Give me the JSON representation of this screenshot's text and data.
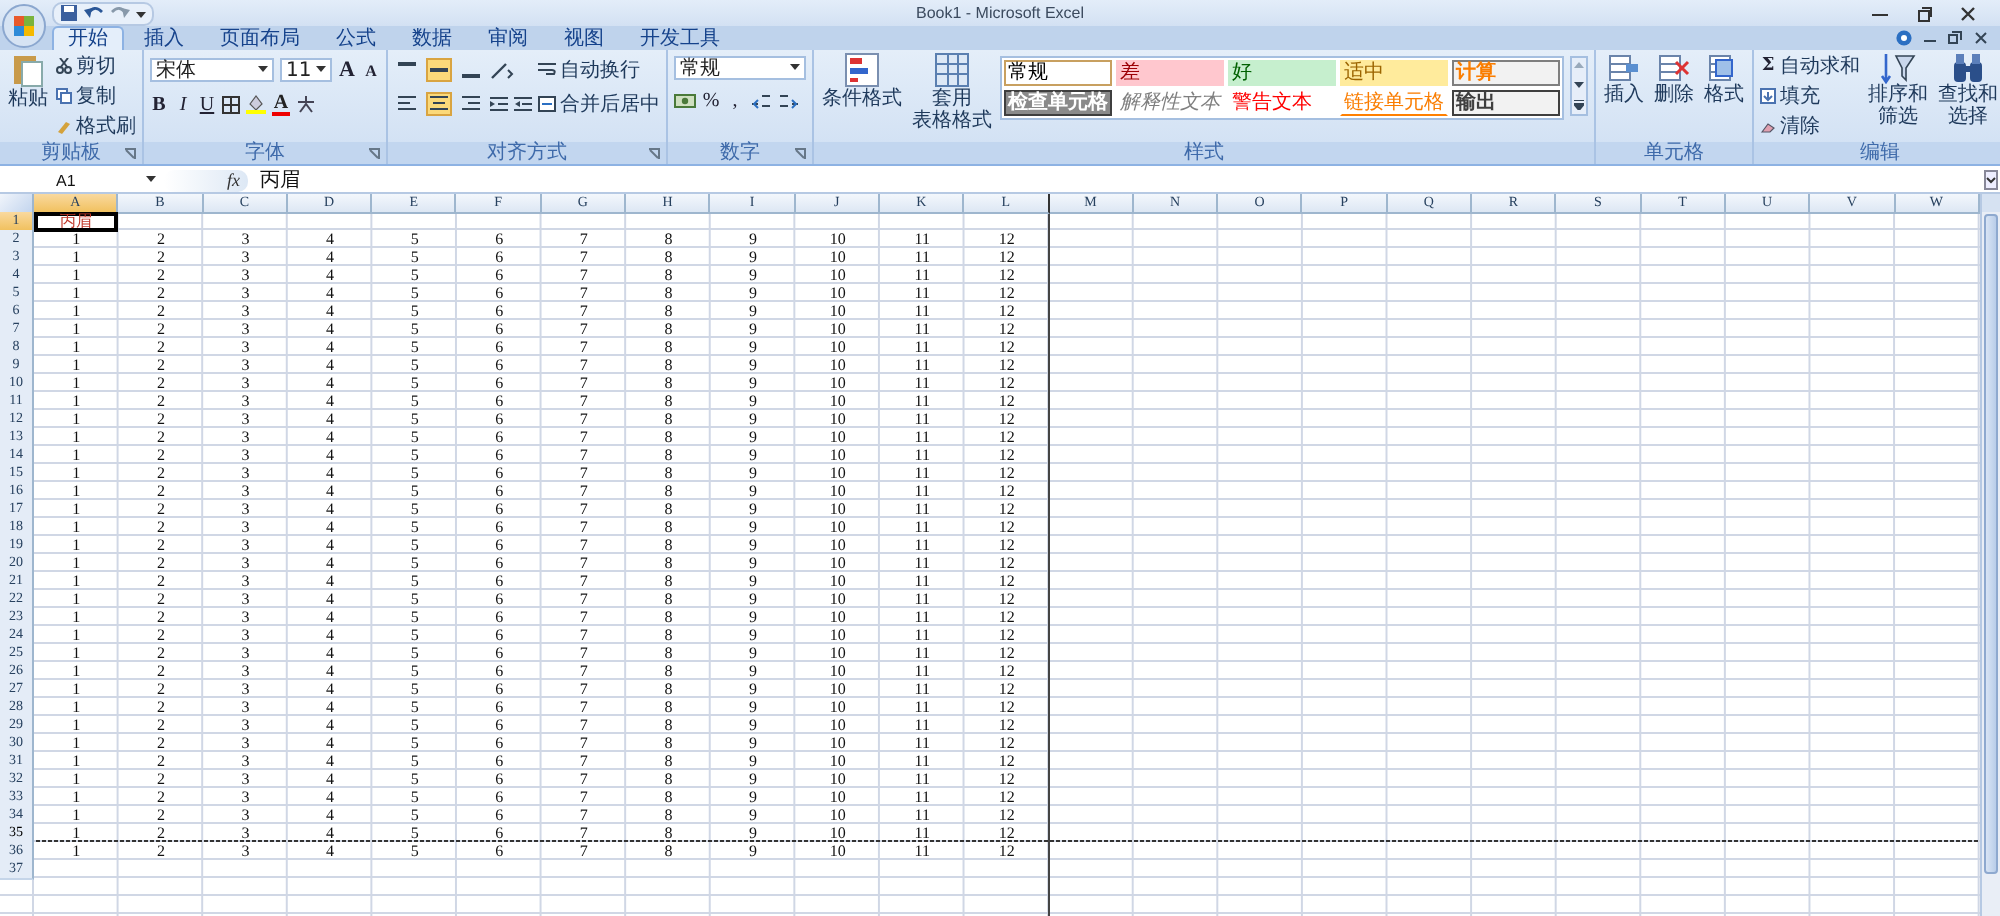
{
  "window": {
    "title": "Book1 - Microsoft Excel"
  },
  "tabs": [
    {
      "label": "开始",
      "selected": true
    },
    {
      "label": "插入",
      "selected": false
    },
    {
      "label": "页面布局",
      "selected": false
    },
    {
      "label": "公式",
      "selected": false
    },
    {
      "label": "数据",
      "selected": false
    },
    {
      "label": "审阅",
      "selected": false
    },
    {
      "label": "视图",
      "selected": false
    },
    {
      "label": "开发工具",
      "selected": false
    }
  ],
  "clipboard": {
    "label": "剪贴板",
    "paste": "粘贴",
    "items": [
      "剪切",
      "复制",
      "格式刷"
    ]
  },
  "font": {
    "label": "字体",
    "font_name": "宋体",
    "font_size": "11",
    "grow": "A",
    "shrink": "A",
    "bold": "B",
    "italic": "I",
    "underline": "U",
    "color_letter": "A"
  },
  "alignment": {
    "label": "对齐方式",
    "vertical": [
      {
        "selected": false
      },
      {
        "selected": true
      },
      {
        "selected": false
      }
    ],
    "horizontal": [
      {
        "selected": false
      },
      {
        "selected": true
      },
      {
        "selected": false
      }
    ],
    "wrap": "自动换行",
    "merge": "合并后居中"
  },
  "number": {
    "label": "数字",
    "format": "常规",
    "percent": "%",
    "comma": ","
  },
  "styles": {
    "label": "样式",
    "conditional": "条件格式",
    "table_format": [
      "套用",
      "表格格式"
    ],
    "cell_styles": [
      {
        "label": "常规",
        "kind": "normal"
      },
      {
        "label": "差",
        "kind": "bad"
      },
      {
        "label": "好",
        "kind": "good"
      },
      {
        "label": "适中",
        "kind": "neutral"
      },
      {
        "label": "计算",
        "kind": "calculation"
      },
      {
        "label": "检查单元格",
        "kind": "check"
      },
      {
        "label": "解释性文本",
        "kind": "explanatory"
      },
      {
        "label": "警告文本",
        "kind": "warning"
      },
      {
        "label": "链接单元格",
        "kind": "linked"
      },
      {
        "label": "输出",
        "kind": "output"
      }
    ]
  },
  "cells": {
    "label": "单元格",
    "buttons": [
      "插入",
      "删除",
      "格式"
    ]
  },
  "editing": {
    "label": "编辑",
    "sum_symbol": "Σ",
    "items": [
      "自动求和",
      "填充",
      "清除"
    ],
    "sort": [
      "排序和",
      "筛选"
    ],
    "find": [
      "查找和",
      "选择"
    ]
  },
  "formula_bar": {
    "name_box": "A1",
    "function_label": "fx",
    "content": "丙眉"
  },
  "columns": [
    {
      "label": "A",
      "selected": true,
      "page_break": false
    },
    {
      "label": "B",
      "selected": false,
      "page_break": false
    },
    {
      "label": "C",
      "selected": false,
      "page_break": false
    },
    {
      "label": "D",
      "selected": false,
      "page_break": false
    },
    {
      "label": "E",
      "selected": false,
      "page_break": false
    },
    {
      "label": "F",
      "selected": false,
      "page_break": false
    },
    {
      "label": "G",
      "selected": false,
      "page_break": false
    },
    {
      "label": "H",
      "selected": false,
      "page_break": false
    },
    {
      "label": "I",
      "selected": false,
      "page_break": false
    },
    {
      "label": "J",
      "selected": false,
      "page_break": false
    },
    {
      "label": "K",
      "selected": false,
      "page_break": false
    },
    {
      "label": "L",
      "selected": false,
      "page_break": true
    },
    {
      "label": "M",
      "selected": false,
      "page_break": false
    },
    {
      "label": "N",
      "selected": false,
      "page_break": false
    },
    {
      "label": "O",
      "selected": false,
      "page_break": false
    },
    {
      "label": "P",
      "selected": false,
      "page_break": false
    },
    {
      "label": "Q",
      "selected": false,
      "page_break": false
    },
    {
      "label": "R",
      "selected": false,
      "page_break": false
    },
    {
      "label": "S",
      "selected": false,
      "page_break": false
    },
    {
      "label": "T",
      "selected": false,
      "page_break": false
    },
    {
      "label": "U",
      "selected": false,
      "page_break": false
    },
    {
      "label": "V",
      "selected": false,
      "page_break": false
    },
    {
      "label": "W",
      "selected": false,
      "page_break": false
    }
  ],
  "rows": [
    {
      "number": "1",
      "selected": true,
      "page_break": false,
      "cells": [
        "丙眉"
      ]
    },
    {
      "number": "2",
      "selected": false,
      "page_break": false,
      "cells": [
        "1",
        "2",
        "3",
        "4",
        "5",
        "6",
        "7",
        "8",
        "9",
        "10",
        "11",
        "12"
      ]
    },
    {
      "number": "3",
      "selected": false,
      "page_break": false,
      "cells": [
        "1",
        "2",
        "3",
        "4",
        "5",
        "6",
        "7",
        "8",
        "9",
        "10",
        "11",
        "12"
      ]
    },
    {
      "number": "4",
      "selected": false,
      "page_break": false,
      "cells": [
        "1",
        "2",
        "3",
        "4",
        "5",
        "6",
        "7",
        "8",
        "9",
        "10",
        "11",
        "12"
      ]
    },
    {
      "number": "5",
      "selected": false,
      "page_break": false,
      "cells": [
        "1",
        "2",
        "3",
        "4",
        "5",
        "6",
        "7",
        "8",
        "9",
        "10",
        "11",
        "12"
      ]
    },
    {
      "number": "6",
      "selected": false,
      "page_break": false,
      "cells": [
        "1",
        "2",
        "3",
        "4",
        "5",
        "6",
        "7",
        "8",
        "9",
        "10",
        "11",
        "12"
      ]
    },
    {
      "number": "7",
      "selected": false,
      "page_break": false,
      "cells": [
        "1",
        "2",
        "3",
        "4",
        "5",
        "6",
        "7",
        "8",
        "9",
        "10",
        "11",
        "12"
      ]
    },
    {
      "number": "8",
      "selected": false,
      "page_break": false,
      "cells": [
        "1",
        "2",
        "3",
        "4",
        "5",
        "6",
        "7",
        "8",
        "9",
        "10",
        "11",
        "12"
      ]
    },
    {
      "number": "9",
      "selected": false,
      "page_break": false,
      "cells": [
        "1",
        "2",
        "3",
        "4",
        "5",
        "6",
        "7",
        "8",
        "9",
        "10",
        "11",
        "12"
      ]
    },
    {
      "number": "10",
      "selected": false,
      "page_break": false,
      "cells": [
        "1",
        "2",
        "3",
        "4",
        "5",
        "6",
        "7",
        "8",
        "9",
        "10",
        "11",
        "12"
      ]
    },
    {
      "number": "11",
      "selected": false,
      "page_break": false,
      "cells": [
        "1",
        "2",
        "3",
        "4",
        "5",
        "6",
        "7",
        "8",
        "9",
        "10",
        "11",
        "12"
      ]
    },
    {
      "number": "12",
      "selected": false,
      "page_break": false,
      "cells": [
        "1",
        "2",
        "3",
        "4",
        "5",
        "6",
        "7",
        "8",
        "9",
        "10",
        "11",
        "12"
      ]
    },
    {
      "number": "13",
      "selected": false,
      "page_break": false,
      "cells": [
        "1",
        "2",
        "3",
        "4",
        "5",
        "6",
        "7",
        "8",
        "9",
        "10",
        "11",
        "12"
      ]
    },
    {
      "number": "14",
      "selected": false,
      "page_break": false,
      "cells": [
        "1",
        "2",
        "3",
        "4",
        "5",
        "6",
        "7",
        "8",
        "9",
        "10",
        "11",
        "12"
      ]
    },
    {
      "number": "15",
      "selected": false,
      "page_break": false,
      "cells": [
        "1",
        "2",
        "3",
        "4",
        "5",
        "6",
        "7",
        "8",
        "9",
        "10",
        "11",
        "12"
      ]
    },
    {
      "number": "16",
      "selected": false,
      "page_break": false,
      "cells": [
        "1",
        "2",
        "3",
        "4",
        "5",
        "6",
        "7",
        "8",
        "9",
        "10",
        "11",
        "12"
      ]
    },
    {
      "number": "17",
      "selected": false,
      "page_break": false,
      "cells": [
        "1",
        "2",
        "3",
        "4",
        "5",
        "6",
        "7",
        "8",
        "9",
        "10",
        "11",
        "12"
      ]
    },
    {
      "number": "18",
      "selected": false,
      "page_break": false,
      "cells": [
        "1",
        "2",
        "3",
        "4",
        "5",
        "6",
        "7",
        "8",
        "9",
        "10",
        "11",
        "12"
      ]
    },
    {
      "number": "19",
      "selected": false,
      "page_break": false,
      "cells": [
        "1",
        "2",
        "3",
        "4",
        "5",
        "6",
        "7",
        "8",
        "9",
        "10",
        "11",
        "12"
      ]
    },
    {
      "number": "20",
      "selected": false,
      "page_break": false,
      "cells": [
        "1",
        "2",
        "3",
        "4",
        "5",
        "6",
        "7",
        "8",
        "9",
        "10",
        "11",
        "12"
      ]
    },
    {
      "number": "21",
      "selected": false,
      "page_break": false,
      "cells": [
        "1",
        "2",
        "3",
        "4",
        "5",
        "6",
        "7",
        "8",
        "9",
        "10",
        "11",
        "12"
      ]
    },
    {
      "number": "22",
      "selected": false,
      "page_break": false,
      "cells": [
        "1",
        "2",
        "3",
        "4",
        "5",
        "6",
        "7",
        "8",
        "9",
        "10",
        "11",
        "12"
      ]
    },
    {
      "number": "23",
      "selected": false,
      "page_break": false,
      "cells": [
        "1",
        "2",
        "3",
        "4",
        "5",
        "6",
        "7",
        "8",
        "9",
        "10",
        "11",
        "12"
      ]
    },
    {
      "number": "24",
      "selected": false,
      "page_break": false,
      "cells": [
        "1",
        "2",
        "3",
        "4",
        "5",
        "6",
        "7",
        "8",
        "9",
        "10",
        "11",
        "12"
      ]
    },
    {
      "number": "25",
      "selected": false,
      "page_break": false,
      "cells": [
        "1",
        "2",
        "3",
        "4",
        "5",
        "6",
        "7",
        "8",
        "9",
        "10",
        "11",
        "12"
      ]
    },
    {
      "number": "26",
      "selected": false,
      "page_break": false,
      "cells": [
        "1",
        "2",
        "3",
        "4",
        "5",
        "6",
        "7",
        "8",
        "9",
        "10",
        "11",
        "12"
      ]
    },
    {
      "number": "27",
      "selected": false,
      "page_break": false,
      "cells": [
        "1",
        "2",
        "3",
        "4",
        "5",
        "6",
        "7",
        "8",
        "9",
        "10",
        "11",
        "12"
      ]
    },
    {
      "number": "28",
      "selected": false,
      "page_break": false,
      "cells": [
        "1",
        "2",
        "3",
        "4",
        "5",
        "6",
        "7",
        "8",
        "9",
        "10",
        "11",
        "12"
      ]
    },
    {
      "number": "29",
      "selected": false,
      "page_break": false,
      "cells": [
        "1",
        "2",
        "3",
        "4",
        "5",
        "6",
        "7",
        "8",
        "9",
        "10",
        "11",
        "12"
      ]
    },
    {
      "number": "30",
      "selected": false,
      "page_break": false,
      "cells": [
        "1",
        "2",
        "3",
        "4",
        "5",
        "6",
        "7",
        "8",
        "9",
        "10",
        "11",
        "12"
      ]
    },
    {
      "number": "31",
      "selected": false,
      "page_break": false,
      "cells": [
        "1",
        "2",
        "3",
        "4",
        "5",
        "6",
        "7",
        "8",
        "9",
        "10",
        "11",
        "12"
      ]
    },
    {
      "number": "32",
      "selected": false,
      "page_break": false,
      "cells": [
        "1",
        "2",
        "3",
        "4",
        "5",
        "6",
        "7",
        "8",
        "9",
        "10",
        "11",
        "12"
      ]
    },
    {
      "number": "33",
      "selected": false,
      "page_break": false,
      "cells": [
        "1",
        "2",
        "3",
        "4",
        "5",
        "6",
        "7",
        "8",
        "9",
        "10",
        "11",
        "12"
      ]
    },
    {
      "number": "34",
      "selected": false,
      "page_break": false,
      "cells": [
        "1",
        "2",
        "3",
        "4",
        "5",
        "6",
        "7",
        "8",
        "9",
        "10",
        "11",
        "12"
      ]
    },
    {
      "number": "35",
      "selected": false,
      "page_break": true,
      "cells": [
        "1",
        "2",
        "3",
        "4",
        "5",
        "6",
        "7",
        "8",
        "9",
        "10",
        "11",
        "12"
      ]
    },
    {
      "number": "36",
      "selected": false,
      "page_break": false,
      "cells": [
        "1",
        "2",
        "3",
        "4",
        "5",
        "6",
        "7",
        "8",
        "9",
        "10",
        "11",
        "12"
      ]
    },
    {
      "number": "37",
      "selected": false,
      "page_break": false
    }
  ]
}
